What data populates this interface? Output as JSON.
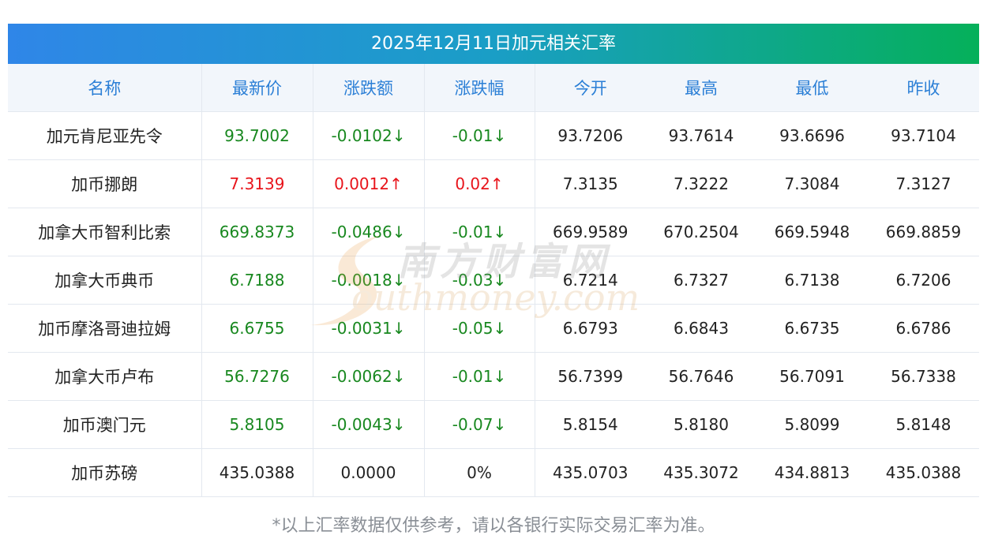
{
  "title": "2025年12月11日加元相关汇率",
  "columns": [
    "名称",
    "最新价",
    "涨跌额",
    "涨跌幅",
    "今开",
    "最高",
    "最低",
    "昨收"
  ],
  "rows": [
    {
      "name": "加元肯尼亚先令",
      "latest": "93.7002",
      "change": "-0.0102↓",
      "pct": "-0.01↓",
      "open": "93.7206",
      "high": "93.7614",
      "low": "93.6696",
      "prev": "93.7104",
      "dir": "down"
    },
    {
      "name": "加币挪朗",
      "latest": "7.3139",
      "change": "0.0012↑",
      "pct": "0.02↑",
      "open": "7.3135",
      "high": "7.3222",
      "low": "7.3084",
      "prev": "7.3127",
      "dir": "up"
    },
    {
      "name": "加拿大币智利比索",
      "latest": "669.8373",
      "change": "-0.0486↓",
      "pct": "-0.01↓",
      "open": "669.9589",
      "high": "670.2504",
      "low": "669.5948",
      "prev": "669.8859",
      "dir": "down"
    },
    {
      "name": "加拿大币典币",
      "latest": "6.7188",
      "change": "-0.0018↓",
      "pct": "-0.03↓",
      "open": "6.7214",
      "high": "6.7327",
      "low": "6.7138",
      "prev": "6.7206",
      "dir": "down"
    },
    {
      "name": "加币摩洛哥迪拉姆",
      "latest": "6.6755",
      "change": "-0.0031↓",
      "pct": "-0.05↓",
      "open": "6.6793",
      "high": "6.6843",
      "low": "6.6735",
      "prev": "6.6786",
      "dir": "down"
    },
    {
      "name": "加拿大币卢布",
      "latest": "56.7276",
      "change": "-0.0062↓",
      "pct": "-0.01↓",
      "open": "56.7399",
      "high": "56.7646",
      "low": "56.7091",
      "prev": "56.7338",
      "dir": "down"
    },
    {
      "name": "加币澳门元",
      "latest": "5.8105",
      "change": "-0.0043↓",
      "pct": "-0.07↓",
      "open": "5.8154",
      "high": "5.8180",
      "low": "5.8099",
      "prev": "5.8148",
      "dir": "down"
    },
    {
      "name": "加币苏磅",
      "latest": "435.0388",
      "change": "0.0000",
      "pct": "0%",
      "open": "435.0703",
      "high": "435.3072",
      "low": "434.8813",
      "prev": "435.0388",
      "dir": "flat"
    }
  ],
  "footnote": "*以上汇率数据仅供参考，请以各银行实际交易汇率为准。",
  "watermark": {
    "cn": "南方财富网",
    "en": "outhmoney.com"
  },
  "colors": {
    "up": "#e8141b",
    "down": "#18881f",
    "header_text": "#2b7fd6",
    "title_grad_start": "#2f86e8",
    "title_grad_end": "#05b05a"
  }
}
